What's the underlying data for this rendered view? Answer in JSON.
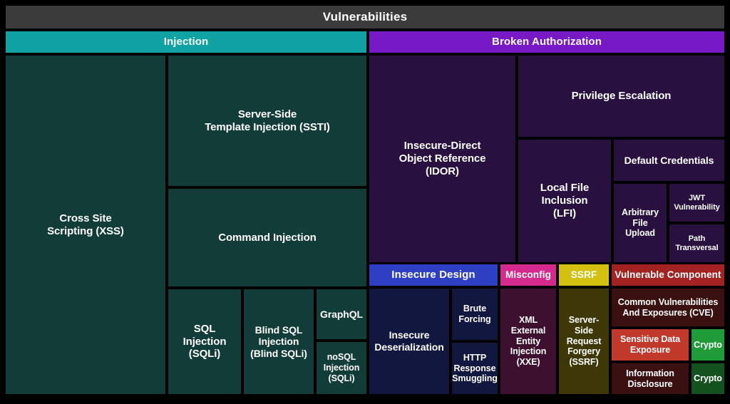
{
  "chart_data": {
    "type": "treemap",
    "title": "Vulnerabilities",
    "grid": false,
    "legend_position": "none",
    "xlabel": "",
    "ylabel": "",
    "groups": [
      {
        "name": "Injection",
        "color": "#11a3a3",
        "children": [
          "Cross Site Scripting (XSS)",
          "Server-Side Template Injection (SSTI)",
          "Command Injection",
          "SQL Injection (SQLi)",
          "Blind SQL Injection (Blind SQLi)",
          "GraphQL",
          "noSQL Injection (SQLi)"
        ]
      },
      {
        "name": "Broken Authorization",
        "color": "#7719c4",
        "children": [
          "Insecure-Direct Object Reference (IDOR)",
          "Privilege Escalation",
          "Local File Inclusion (LFI)",
          "Default Credentials",
          "Arbitrary File Upload",
          "JWT Vulnerability",
          "Path Transversal"
        ]
      },
      {
        "name": "Insecure Design",
        "color": "#2f3fc4",
        "children": [
          "Insecure Deserialization",
          "Brute Forcing",
          "HTTP Response Smuggling"
        ]
      },
      {
        "name": "Misconfig",
        "color": "#d42a8e",
        "children": [
          "XML External Entity Injection (XXE)"
        ]
      },
      {
        "name": "SSRF",
        "color": "#d4c011",
        "children": [
          "Server-Side Request Forgery (SSRF)"
        ]
      },
      {
        "name": "Vulnerable Component",
        "color": "#a32222",
        "children": [
          "Common Vulnerabilities And Exposures (CVE)",
          "Sensitive Data Exposure",
          "Crypto",
          "Information Disclosure",
          "Crypto"
        ]
      }
    ]
  },
  "root": {
    "label": "Vulnerabilities",
    "color": "#3b3b3b"
  },
  "headers": {
    "injection": {
      "label": "Injection",
      "color": "#11a3a3"
    },
    "broken_authorization": {
      "label": "Broken Authorization",
      "color": "#7719c4"
    },
    "insecure_design": {
      "label": "Insecure Design",
      "color": "#2f3fc4"
    },
    "misconfig": {
      "label": "Misconfig",
      "color": "#d42a8e"
    },
    "ssrf": {
      "label": "SSRF",
      "color": "#d4c011"
    },
    "vulnerable_component": {
      "label": "Vulnerable Component",
      "color": "#a32222"
    }
  },
  "cells": {
    "xss": {
      "label": "Cross Site\nScripting (XSS)",
      "color": "#113c38"
    },
    "ssti": {
      "label": "Server-Side\nTemplate Injection (SSTI)",
      "color": "#113c38"
    },
    "command_injection": {
      "label": "Command Injection",
      "color": "#113c38"
    },
    "sqli": {
      "label": "SQL\nInjection\n(SQLi)",
      "color": "#113c38"
    },
    "blind_sqli": {
      "label": "Blind SQL\nInjection\n(Blind SQLi)",
      "color": "#113c38"
    },
    "graphql": {
      "label": "GraphQL",
      "color": "#113c38"
    },
    "nosql": {
      "label": "noSQL\nInjection\n(SQLi)",
      "color": "#113c38"
    },
    "idor": {
      "label": "Insecure-Direct\nObject Reference\n(IDOR)",
      "color": "#28113f"
    },
    "privilege_escalation": {
      "label": "Privilege Escalation",
      "color": "#28113f"
    },
    "lfi": {
      "label": "Local File\nInclusion\n(LFI)",
      "color": "#28113f"
    },
    "default_credentials": {
      "label": "Default Credentials",
      "color": "#28113f"
    },
    "arbitrary_file_upload": {
      "label": "Arbitrary\nFile\nUpload",
      "color": "#28113f"
    },
    "jwt_vulnerability": {
      "label": "JWT\nVulnerability",
      "color": "#28113f"
    },
    "path_transversal": {
      "label": "Path\nTransversal",
      "color": "#28113f"
    },
    "insecure_deserialization": {
      "label": "Insecure\nDeserialization",
      "color": "#11173f"
    },
    "brute_forcing": {
      "label": "Brute\nForcing",
      "color": "#11173f"
    },
    "http_response_smuggling": {
      "label": "HTTP\nResponse\nSmuggling",
      "color": "#11173f"
    },
    "xxe": {
      "label": "XML\nExternal\nEntity\nInjection\n(XXE)",
      "color": "#3d1030"
    },
    "ssrf_cell": {
      "label": "Server-Side\nRequest\nForgery\n(SSRF)",
      "color": "#3d3805"
    },
    "cve": {
      "label": "Common Vulnerabilities\nAnd Exposures (CVE)",
      "color": "#3b1010"
    },
    "sensitive_data_exposure": {
      "label": "Sensitive Data\nExposure",
      "color": "#c0392b"
    },
    "crypto_top": {
      "label": "Crypto",
      "color": "#1f9b37"
    },
    "information_disclosure": {
      "label": "Information\nDisclosure",
      "color": "#3b1010"
    },
    "crypto_bottom": {
      "label": "Crypto",
      "color": "#13521f"
    }
  }
}
